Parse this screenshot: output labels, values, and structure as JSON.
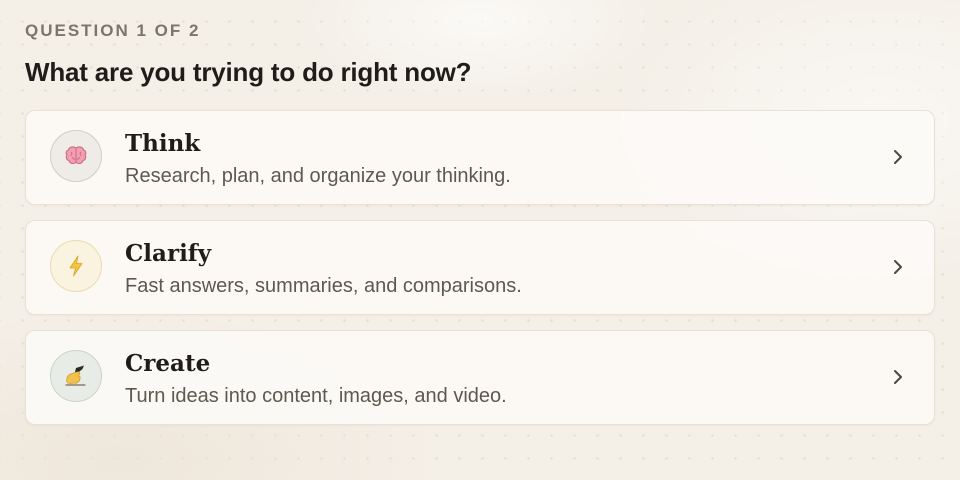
{
  "header": {
    "eyebrow": "QUESTION 1 OF 2",
    "question": "What are you trying to do right now?"
  },
  "options": [
    {
      "title": "Think",
      "description": "Research, plan, and organize your thinking.",
      "icon": "brain-icon"
    },
    {
      "title": "Clarify",
      "description": "Fast answers, summaries, and comparisons.",
      "icon": "lightning-icon"
    },
    {
      "title": "Create",
      "description": "Turn ideas into content, images, and video.",
      "icon": "writing-hand-icon"
    }
  ],
  "colors": {
    "background": "#f4efe7",
    "card": "#fcfaf6",
    "title": "#1f1c19",
    "muted": "#7b756d",
    "accent_yellow": "#e9b93c"
  }
}
